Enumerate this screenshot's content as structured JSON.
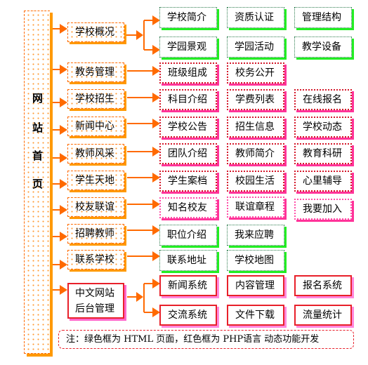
{
  "diagram": {
    "root": {
      "label_chars": [
        "网",
        "站",
        "首",
        "页"
      ],
      "label": "网站首页"
    },
    "legend_colors": {
      "html_frame": "#22ee22",
      "php_frame": "#e8202a",
      "section_frame": "#ff6a00"
    },
    "sections": [
      {
        "label": "学校概况",
        "rows": [
          [
            "学校简介",
            "资质认证",
            "管理结构"
          ],
          [
            "学园景观",
            "学园活动",
            "教学设备"
          ]
        ],
        "frame": "green"
      },
      {
        "label": "教务管理",
        "rows": [
          [
            "班级组成",
            "校务公开"
          ]
        ],
        "frame": "red"
      },
      {
        "label": "学校招生",
        "rows": [
          [
            "科目介绍",
            "学费列表",
            "在线报名"
          ]
        ],
        "frame": "red"
      },
      {
        "label": "新闻中心",
        "rows": [
          [
            "学校公告",
            "招生信息",
            "学校动态"
          ]
        ],
        "frame": "red"
      },
      {
        "label": "教师风采",
        "rows": [
          [
            "团队介绍",
            "教师简介",
            "教育科研"
          ]
        ],
        "frame": "red"
      },
      {
        "label": "学生天地",
        "rows": [
          [
            "学生案档",
            "校园生活",
            "心里辅导"
          ]
        ],
        "frame": "red"
      },
      {
        "label": "校友联谊",
        "rows": [
          [
            "知名校友",
            "联谊章程",
            "我要加入"
          ]
        ],
        "frame": "pink"
      },
      {
        "label": "招聘教师",
        "rows": [
          [
            "职位介绍",
            "我来应聘"
          ]
        ],
        "frame": "green"
      },
      {
        "label": "联系学校",
        "rows": [
          [
            "联系地址",
            "学校地图"
          ]
        ],
        "frame": "green"
      },
      {
        "label_lines": [
          "中文网站",
          "后台管理"
        ],
        "rows": [
          [
            "新闻系统",
            "内容管理",
            "报名系统"
          ],
          [
            "交流系统",
            "文件下载",
            "流量统计"
          ]
        ],
        "frame": "solidred"
      }
    ],
    "note": "注：绿色框为 HTML 页面，红色框为 PHP语言 动态功能开发"
  }
}
